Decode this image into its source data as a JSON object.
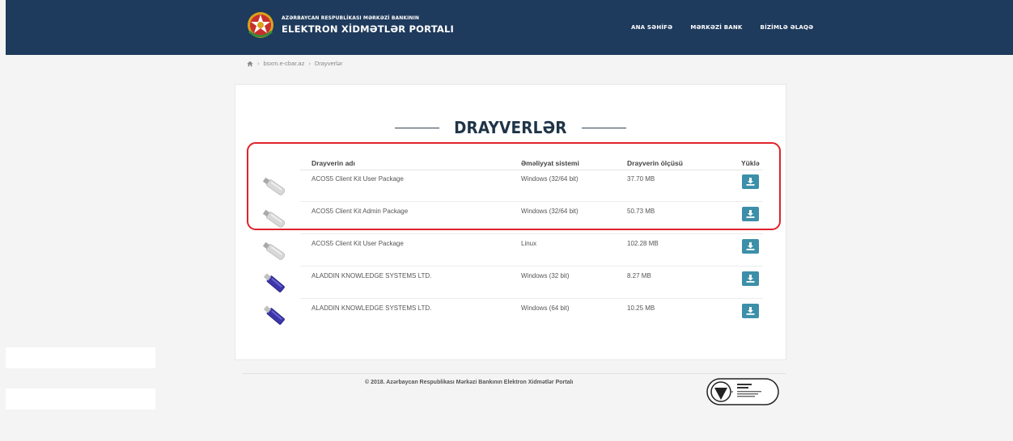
{
  "header": {
    "org_name": "AZƏRBAYCAN RESPUBLİKASI MƏRKƏZİ BANKININ",
    "portal_name": "ELEKTRON XİDMƏTLƏR PORTALI",
    "nav": [
      "ANA SƏHİFƏ",
      "MƏRKƏZİ BANK",
      "BİZİMLƏ ƏLAQƏ"
    ],
    "bg_color": "#1e3a5c"
  },
  "breadcrumb": {
    "items": [
      "bsxm.e-cbar.az",
      "Drayverlər"
    ],
    "home_icon": "home-icon"
  },
  "page": {
    "title": "DRAYVERLƏR"
  },
  "table": {
    "columns": [
      "Drayverin adı",
      "Əməliyyat sistemi",
      "Drayverin ölçüsü",
      "Yüklə"
    ],
    "rows": [
      {
        "name": "ACOS5 Client Kit User Package",
        "os": "Windows (32/64 bit)",
        "size": "37.70 MB",
        "device": "usb-token-white"
      },
      {
        "name": "ACOS5 Client Kit Admin Package",
        "os": "Windows (32/64 bit)",
        "size": "50.73 MB",
        "device": "usb-token-white"
      },
      {
        "name": "ACOS5 Client Kit User Package",
        "os": "Linux",
        "size": "102.28 MB",
        "device": "usb-token-white"
      },
      {
        "name": "ALADDIN KNOWLEDGE SYSTEMS LTD.",
        "os": "Windows (32 bit)",
        "size": "8.27 MB",
        "device": "usb-token-blue"
      },
      {
        "name": "ALADDIN KNOWLEDGE SYSTEMS LTD.",
        "os": "Windows (64 bit)",
        "size": "10.25 MB",
        "device": "usb-token-blue"
      }
    ],
    "download_icon": "download-icon",
    "button_color": "#3d8fa9"
  },
  "highlight": {
    "color": "#e0222c"
  },
  "footer": {
    "copyright": "© 2018. Azərbaycan Respublikası Mərkəzi Bankının Elektron Xidmətlər Portalı",
    "badge_icon": "bsi-iso-27001-icon"
  }
}
